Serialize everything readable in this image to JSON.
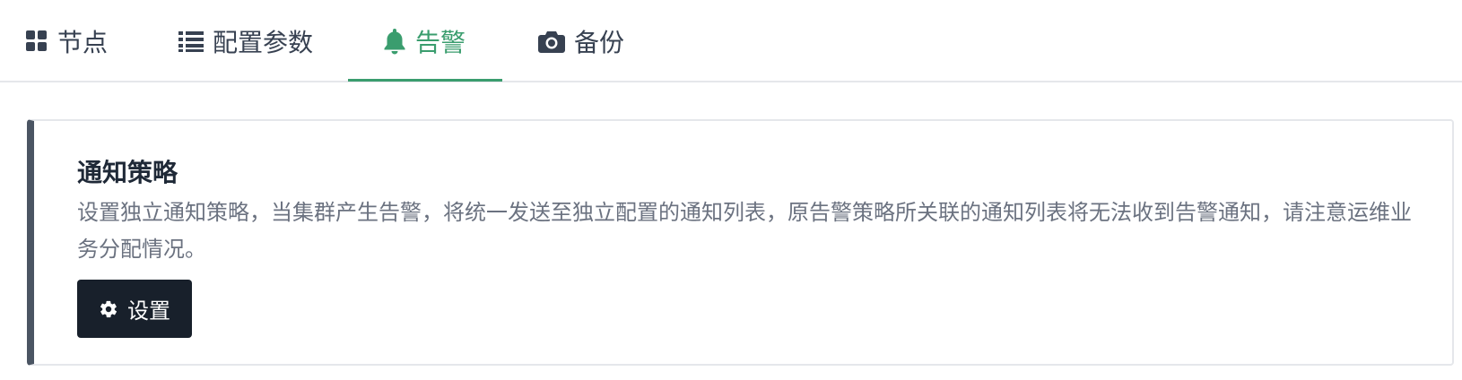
{
  "tabs": [
    {
      "label": "节点",
      "icon": "grid-icon",
      "active": false
    },
    {
      "label": "配置参数",
      "icon": "list-icon",
      "active": false
    },
    {
      "label": "告警",
      "icon": "bell-icon",
      "active": true
    },
    {
      "label": "备份",
      "icon": "camera-icon",
      "active": false
    }
  ],
  "card": {
    "title": "通知策略",
    "description": "设置独立通知策略，当集群产生告警，将统一发送至独立配置的通知列表，原告警策略所关联的通知列表将无法收到告警通知，请注意运维业务分配情况。",
    "button_label": "设置",
    "button_icon": "gear-icon"
  },
  "colors": {
    "accent": "#3a9d6e",
    "card_border_left": "#4b5563",
    "button_bg": "#18202b"
  }
}
